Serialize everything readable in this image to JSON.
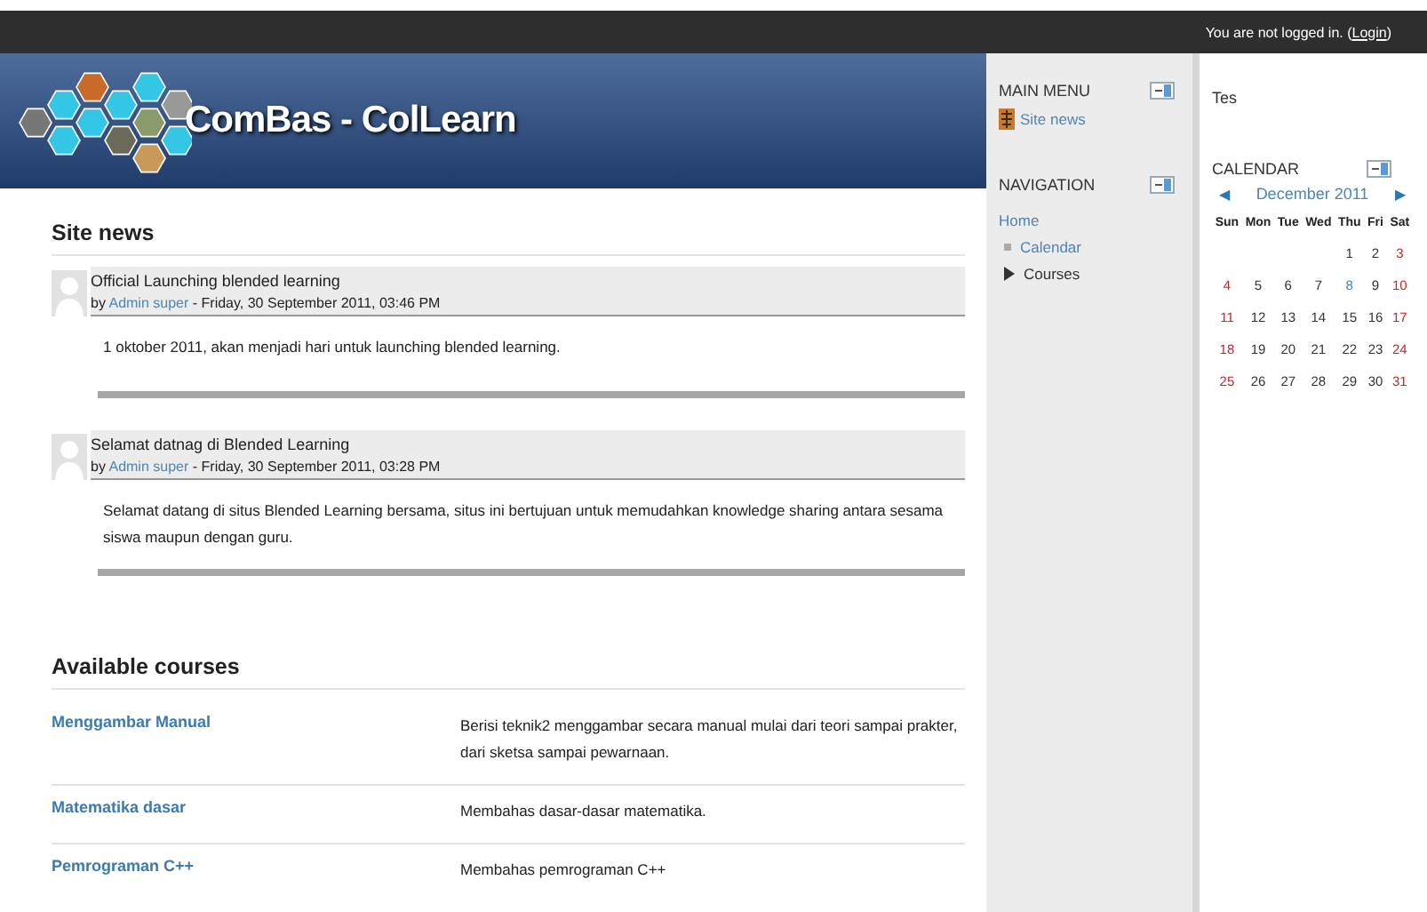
{
  "top_bar": {
    "login_text": "You are not logged in. (",
    "login_link": "Login",
    "login_end": ")"
  },
  "header": {
    "site_name": "ComBas - ColLearn"
  },
  "site_news": {
    "title": "Site news",
    "posts": [
      {
        "subject": "Official Launching blended learning",
        "by": "by",
        "author": "Admin super",
        "date": "- Friday, 30 September 2011, 03:46 PM",
        "body": "1 oktober 2011, akan menjadi hari untuk launching blended learning."
      },
      {
        "subject": "Selamat datnag di Blended Learning",
        "by": "by",
        "author": "Admin super",
        "date": "- Friday, 30 September 2011, 03:28 PM",
        "body": "Selamat datang di situs Blended Learning bersama, situs ini bertujuan untuk memudahkan knowledge sharing antara sesama siswa maupun dengan guru."
      }
    ]
  },
  "available_courses": {
    "title": "Available courses",
    "courses": [
      {
        "name": "Menggambar Manual",
        "summary": "Berisi teknik2 menggambar secara manual mulai dari teori sampai prakter, dari sketsa sampai pewarnaan."
      },
      {
        "name": "Matematika dasar",
        "summary": "Membahas dasar-dasar matematika."
      },
      {
        "name": "Pemrograman C++",
        "summary": "Membahas pemrograman C++"
      }
    ]
  },
  "main_menu": {
    "title": "MAIN MENU",
    "items": [
      "Site news"
    ]
  },
  "navigation": {
    "title": "NAVIGATION",
    "items": [
      {
        "label": "Home",
        "kind": "link"
      },
      {
        "label": "Calendar",
        "kind": "bullet"
      },
      {
        "label": "Courses",
        "kind": "branch",
        "expanded": false
      }
    ]
  },
  "right_text": "Tes",
  "calendar": {
    "title": "CALENDAR",
    "prev": "◀",
    "month": "December 2011",
    "next": "▶",
    "weekdays": [
      "Sun",
      "Mon",
      "Tue",
      "Wed",
      "Thu",
      "Fri",
      "Sat"
    ],
    "weeks": [
      [
        {
          "kind": "blank"
        },
        {
          "kind": "blank"
        },
        {
          "kind": "blank"
        },
        {
          "kind": "blank"
        },
        {
          "day": "1",
          "kind": "day"
        },
        {
          "day": "2",
          "kind": "day"
        },
        {
          "day": "3",
          "kind": "weekend"
        }
      ],
      [
        {
          "day": "4",
          "kind": "weekend"
        },
        {
          "day": "5",
          "kind": "day"
        },
        {
          "day": "6",
          "kind": "day"
        },
        {
          "day": "7",
          "kind": "day"
        },
        {
          "day": "8",
          "kind": "today"
        },
        {
          "day": "9",
          "kind": "day"
        },
        {
          "day": "10",
          "kind": "weekend"
        }
      ],
      [
        {
          "day": "11",
          "kind": "weekend"
        },
        {
          "day": "12",
          "kind": "day"
        },
        {
          "day": "13",
          "kind": "day"
        },
        {
          "day": "14",
          "kind": "day"
        },
        {
          "day": "15",
          "kind": "day"
        },
        {
          "day": "16",
          "kind": "day"
        },
        {
          "day": "17",
          "kind": "weekend"
        }
      ],
      [
        {
          "day": "18",
          "kind": "weekend"
        },
        {
          "day": "19",
          "kind": "day"
        },
        {
          "day": "20",
          "kind": "day"
        },
        {
          "day": "21",
          "kind": "day"
        },
        {
          "day": "22",
          "kind": "day"
        },
        {
          "day": "23",
          "kind": "day"
        },
        {
          "day": "24",
          "kind": "weekend"
        }
      ],
      [
        {
          "day": "25",
          "kind": "weekend"
        },
        {
          "day": "26",
          "kind": "day"
        },
        {
          "day": "27",
          "kind": "day"
        },
        {
          "day": "28",
          "kind": "day"
        },
        {
          "day": "29",
          "kind": "day"
        },
        {
          "day": "30",
          "kind": "day"
        },
        {
          "day": "31",
          "kind": "weekend"
        }
      ]
    ]
  }
}
